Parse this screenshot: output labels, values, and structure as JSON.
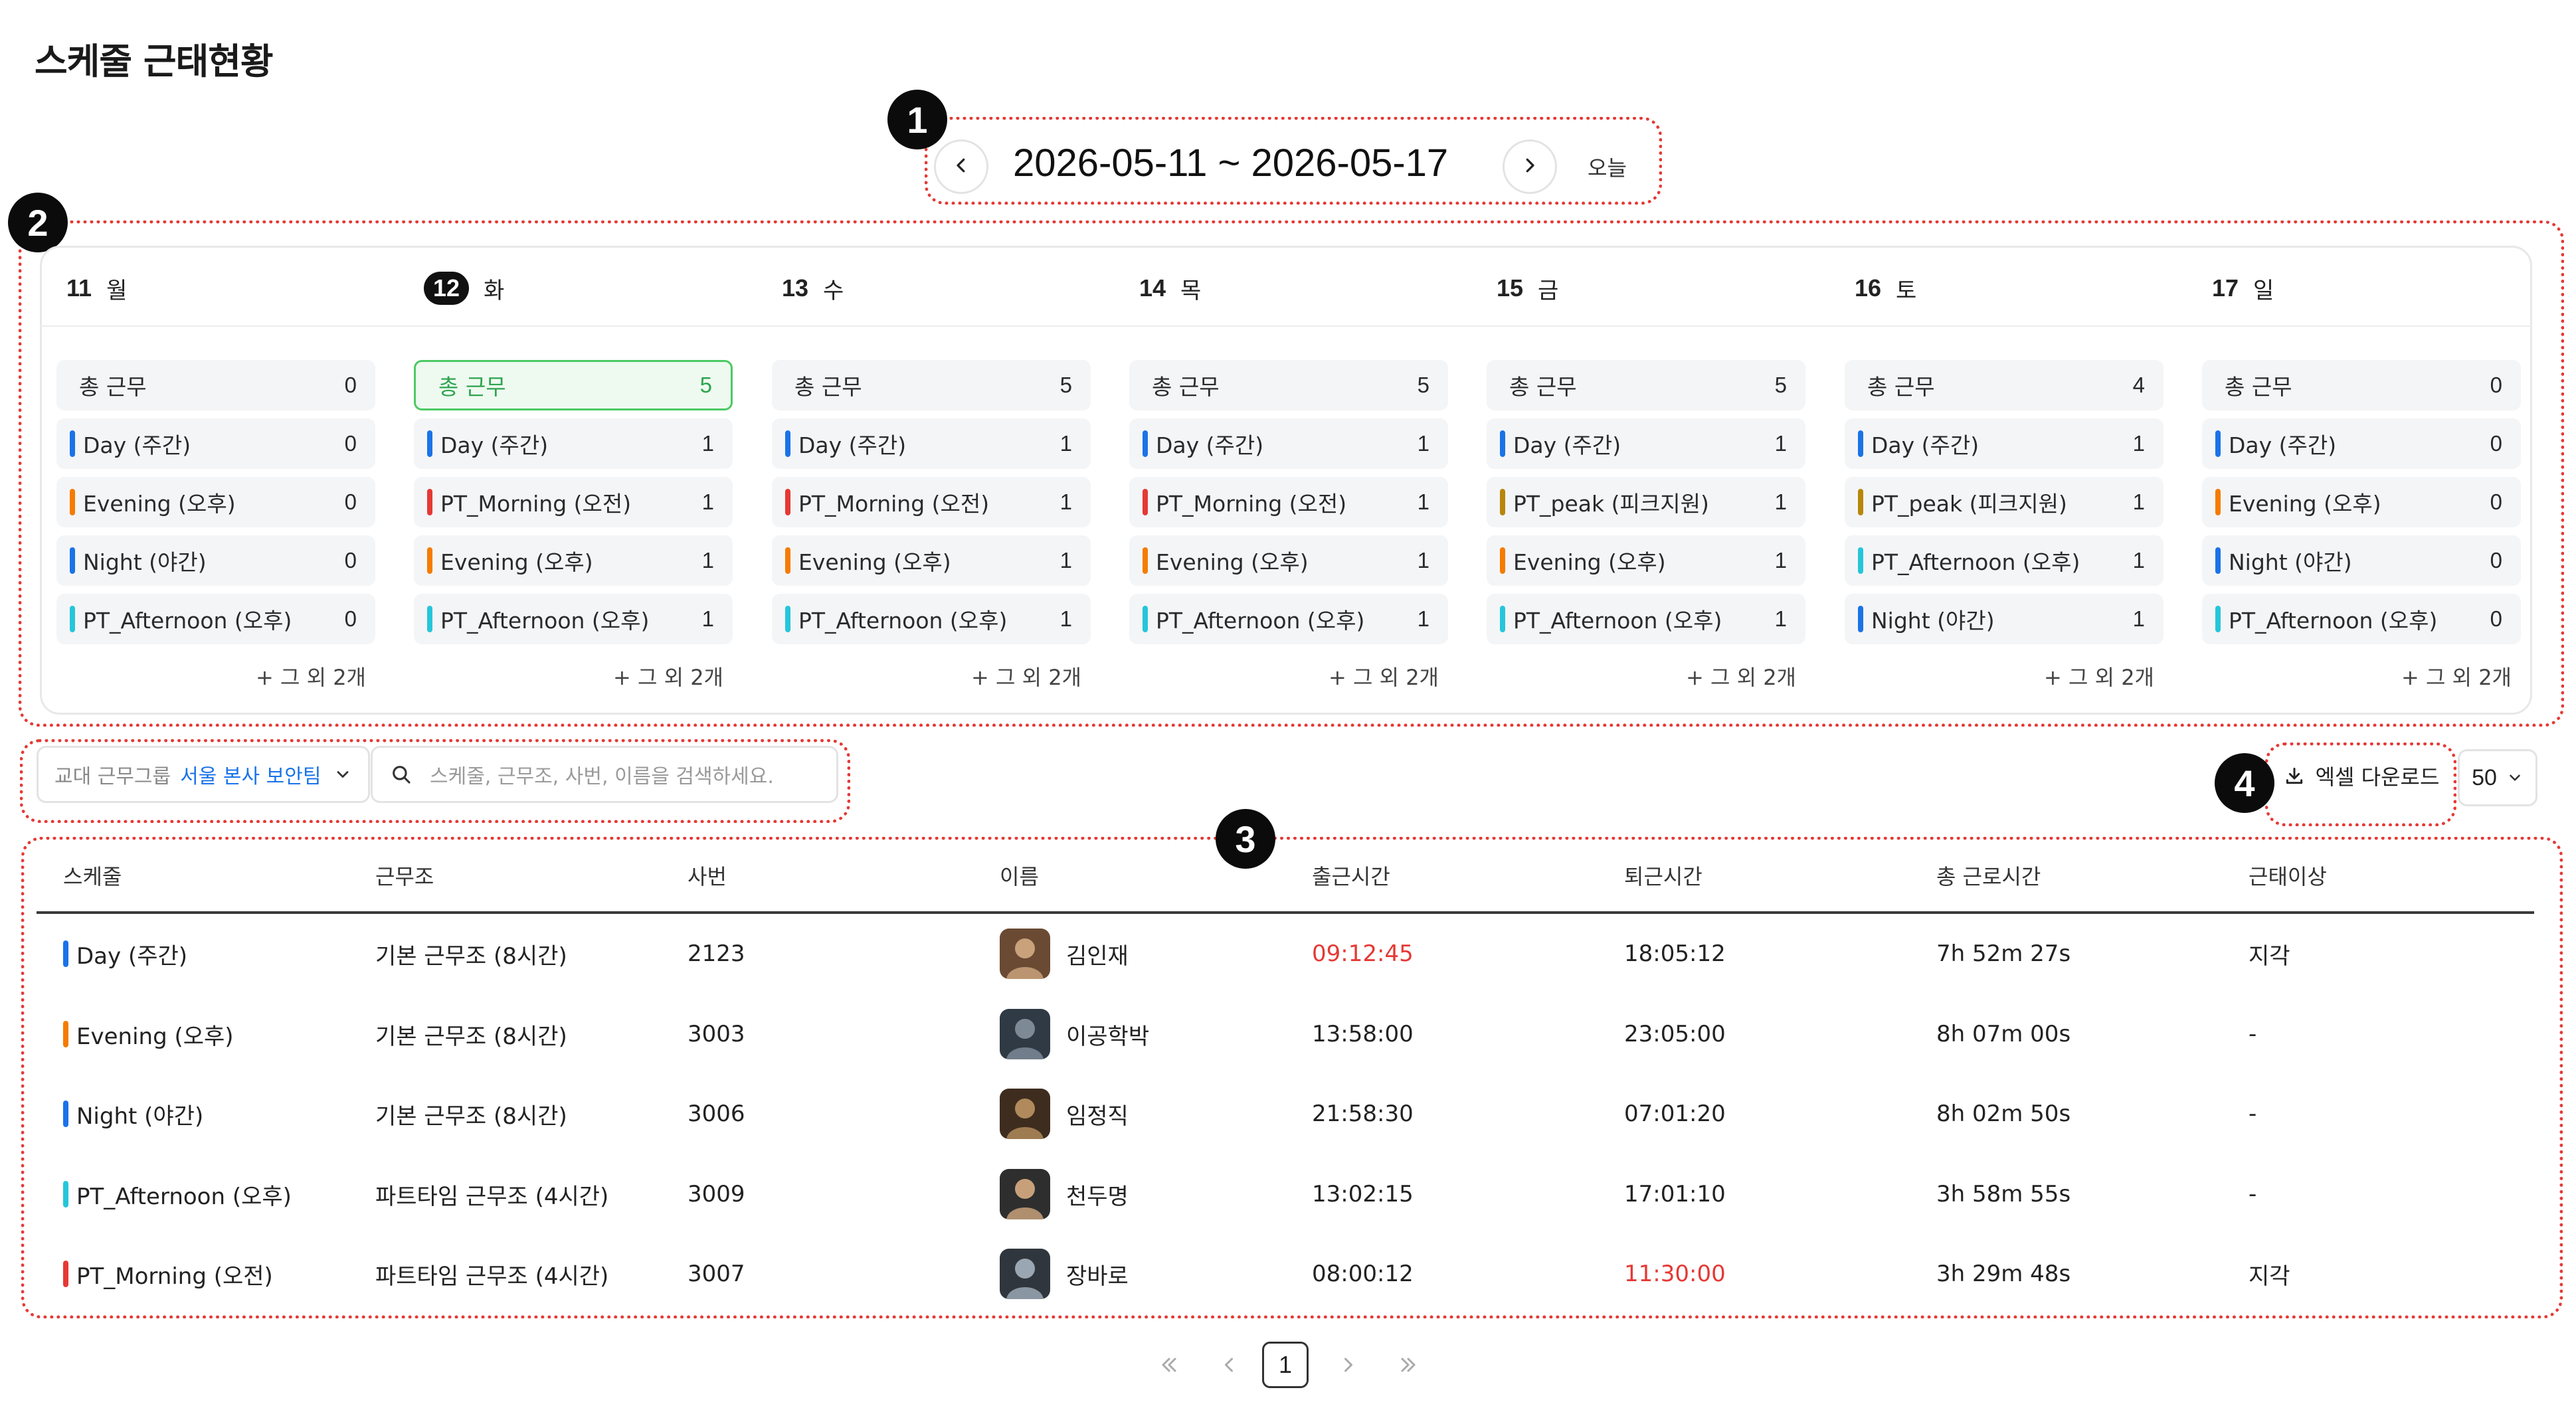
{
  "page": {
    "title": "스케줄 근태현황"
  },
  "markers": [
    "1",
    "2",
    "3",
    "4"
  ],
  "date_nav": {
    "range": "2026-05-11 ~ 2026-05-17",
    "today": "오늘"
  },
  "colors": {
    "day": "#1a73e8",
    "evening": "#f57c00",
    "night": "#1a73e8",
    "pt_afternoon": "#26c6da",
    "pt_morning": "#e53935",
    "pt_peak": "#b8860b",
    "late": "#e53935",
    "today_highlight": "#4cca63"
  },
  "calendar": {
    "days": [
      {
        "num": "11",
        "dow": "월",
        "today": false,
        "total_label": "총 근무",
        "total": "0",
        "items": [
          {
            "label": "Day (주간)",
            "value": "0",
            "color": "#1a73e8"
          },
          {
            "label": "Evening (오후)",
            "value": "0",
            "color": "#f57c00"
          },
          {
            "label": "Night (야간)",
            "value": "0",
            "color": "#1a73e8"
          },
          {
            "label": "PT_Afternoon (오후)",
            "value": "0",
            "color": "#26c6da"
          }
        ],
        "more": "+ 그 외 2개"
      },
      {
        "num": "12",
        "dow": "화",
        "today": true,
        "total_label": "총 근무",
        "total": "5",
        "items": [
          {
            "label": "Day (주간)",
            "value": "1",
            "color": "#1a73e8"
          },
          {
            "label": "PT_Morning (오전)",
            "value": "1",
            "color": "#e53935"
          },
          {
            "label": "Evening (오후)",
            "value": "1",
            "color": "#f57c00"
          },
          {
            "label": "PT_Afternoon (오후)",
            "value": "1",
            "color": "#26c6da"
          }
        ],
        "more": "+ 그 외 2개"
      },
      {
        "num": "13",
        "dow": "수",
        "today": false,
        "total_label": "총 근무",
        "total": "5",
        "items": [
          {
            "label": "Day (주간)",
            "value": "1",
            "color": "#1a73e8"
          },
          {
            "label": "PT_Morning (오전)",
            "value": "1",
            "color": "#e53935"
          },
          {
            "label": "Evening (오후)",
            "value": "1",
            "color": "#f57c00"
          },
          {
            "label": "PT_Afternoon (오후)",
            "value": "1",
            "color": "#26c6da"
          }
        ],
        "more": "+ 그 외 2개"
      },
      {
        "num": "14",
        "dow": "목",
        "today": false,
        "total_label": "총 근무",
        "total": "5",
        "items": [
          {
            "label": "Day (주간)",
            "value": "1",
            "color": "#1a73e8"
          },
          {
            "label": "PT_Morning (오전)",
            "value": "1",
            "color": "#e53935"
          },
          {
            "label": "Evening (오후)",
            "value": "1",
            "color": "#f57c00"
          },
          {
            "label": "PT_Afternoon (오후)",
            "value": "1",
            "color": "#26c6da"
          }
        ],
        "more": "+ 그 외 2개"
      },
      {
        "num": "15",
        "dow": "금",
        "today": false,
        "total_label": "총 근무",
        "total": "5",
        "items": [
          {
            "label": "Day (주간)",
            "value": "1",
            "color": "#1a73e8"
          },
          {
            "label": "PT_peak (피크지원)",
            "value": "1",
            "color": "#b8860b"
          },
          {
            "label": "Evening (오후)",
            "value": "1",
            "color": "#f57c00"
          },
          {
            "label": "PT_Afternoon (오후)",
            "value": "1",
            "color": "#26c6da"
          }
        ],
        "more": "+ 그 외 2개"
      },
      {
        "num": "16",
        "dow": "토",
        "today": false,
        "total_label": "총 근무",
        "total": "4",
        "items": [
          {
            "label": "Day (주간)",
            "value": "1",
            "color": "#1a73e8"
          },
          {
            "label": "PT_peak (피크지원)",
            "value": "1",
            "color": "#b8860b"
          },
          {
            "label": "PT_Afternoon (오후)",
            "value": "1",
            "color": "#26c6da"
          },
          {
            "label": "Night (야간)",
            "value": "1",
            "color": "#1a73e8"
          }
        ],
        "more": "+ 그 외 2개"
      },
      {
        "num": "17",
        "dow": "일",
        "today": false,
        "total_label": "총 근무",
        "total": "0",
        "items": [
          {
            "label": "Day (주간)",
            "value": "0",
            "color": "#1a73e8"
          },
          {
            "label": "Evening (오후)",
            "value": "0",
            "color": "#f57c00"
          },
          {
            "label": "Night (야간)",
            "value": "0",
            "color": "#1a73e8"
          },
          {
            "label": "PT_Afternoon (오후)",
            "value": "0",
            "color": "#26c6da"
          }
        ],
        "more": "+ 그 외 2개"
      }
    ]
  },
  "filters": {
    "group_label": "교대 근무그룹",
    "group_value": "서울 본사 보안팀",
    "search_placeholder": "스케줄, 근무조, 사번, 이름을 검색하세요."
  },
  "toolbar": {
    "excel_label": "엑셀 다운로드",
    "page_size": "50"
  },
  "table": {
    "headers": [
      "스케줄",
      "근무조",
      "사번",
      "이름",
      "출근시간",
      "퇴근시간",
      "총 근로시간",
      "근태이상"
    ],
    "rows": [
      {
        "schedule": "Day (주간)",
        "color": "#1a73e8",
        "group": "기본 근무조 (8시간)",
        "emp_no": "2123",
        "name": "김인재",
        "in": "09:12:45",
        "in_late": true,
        "out": "18:05:12",
        "out_late": false,
        "total": "7h 52m 27s",
        "issue": "지각"
      },
      {
        "schedule": "Evening (오후)",
        "color": "#f57c00",
        "group": "기본 근무조 (8시간)",
        "emp_no": "3003",
        "name": "이공학박",
        "in": "13:58:00",
        "in_late": false,
        "out": "23:05:00",
        "out_late": false,
        "total": "8h 07m 00s",
        "issue": "-"
      },
      {
        "schedule": "Night (야간)",
        "color": "#1a73e8",
        "group": "기본 근무조 (8시간)",
        "emp_no": "3006",
        "name": "임정직",
        "in": "21:58:30",
        "in_late": false,
        "out": "07:01:20",
        "out_late": false,
        "total": "8h 02m 50s",
        "issue": "-"
      },
      {
        "schedule": "PT_Afternoon (오후)",
        "color": "#26c6da",
        "group": "파트타임 근무조 (4시간)",
        "emp_no": "3009",
        "name": "천두명",
        "in": "13:02:15",
        "in_late": false,
        "out": "17:01:10",
        "out_late": false,
        "total": "3h 58m 55s",
        "issue": "-"
      },
      {
        "schedule": "PT_Morning (오전)",
        "color": "#e53935",
        "group": "파트타임 근무조 (4시간)",
        "emp_no": "3007",
        "name": "장바로",
        "in": "08:00:12",
        "in_late": false,
        "out": "11:30:00",
        "out_late": true,
        "total": "3h 29m 48s",
        "issue": "지각"
      }
    ]
  },
  "pagination": {
    "current": "1"
  }
}
